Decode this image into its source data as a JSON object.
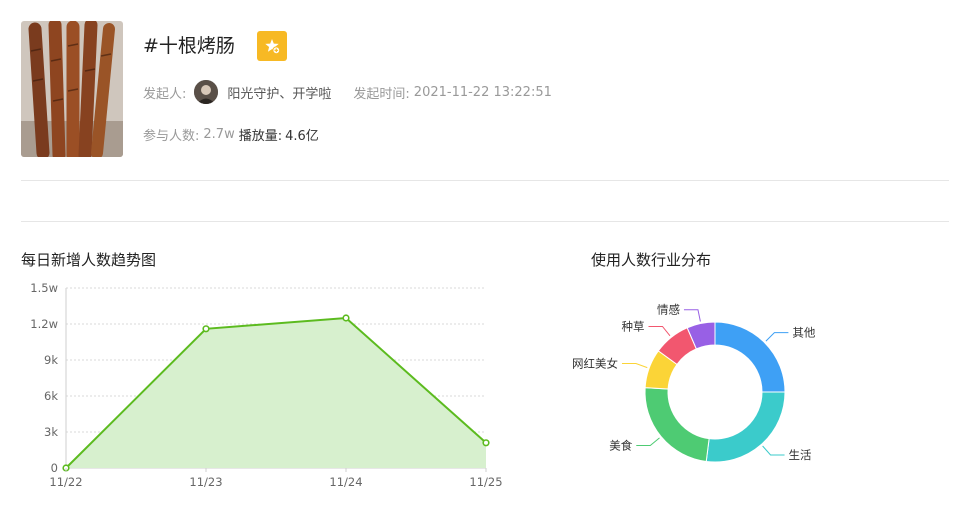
{
  "topic": {
    "title": "#十根烤肠",
    "creator_label": "发起人:",
    "creator_name": "阳光守护、开学啦",
    "time_label": "发起时间:",
    "time_value": "2021-11-22 13:22:51",
    "participants_label": "参与人数:",
    "participants_value": "2.7w",
    "plays_label": "播放量:",
    "plays_value": "4.6亿"
  },
  "colors": {
    "accent": "#f7b924",
    "line": "#5cbb1f",
    "area": "#d7f0ce"
  },
  "icons": {
    "favorite": "star-plus-icon"
  },
  "daily_chart_title": "每日新增人数趋势图",
  "industry_chart_title": "使用人数行业分布",
  "chart_data": [
    {
      "type": "area",
      "title": "每日新增人数趋势图",
      "x": [
        "11/22",
        "11/23",
        "11/24",
        "11/25"
      ],
      "y_ticks": [
        "0",
        "3k",
        "6k",
        "9k",
        "1.2w",
        "1.5w"
      ],
      "ylim": [
        0,
        15000
      ],
      "series": [
        {
          "values": [
            0,
            11600,
            12500,
            2100
          ]
        }
      ],
      "grid": true
    },
    {
      "type": "pie",
      "title": "使用人数行业分布",
      "donut": true,
      "slices": [
        {
          "label": "其他",
          "value": 25,
          "color": "#3ea0f5"
        },
        {
          "label": "生活",
          "value": 27,
          "color": "#3bcbcb"
        },
        {
          "label": "美食",
          "value": 24,
          "color": "#4ecb73"
        },
        {
          "label": "网红美女",
          "value": 9,
          "color": "#fbd437"
        },
        {
          "label": "种草",
          "value": 8.5,
          "color": "#f2576f"
        },
        {
          "label": "情感",
          "value": 6.5,
          "color": "#9860e5"
        }
      ]
    }
  ]
}
